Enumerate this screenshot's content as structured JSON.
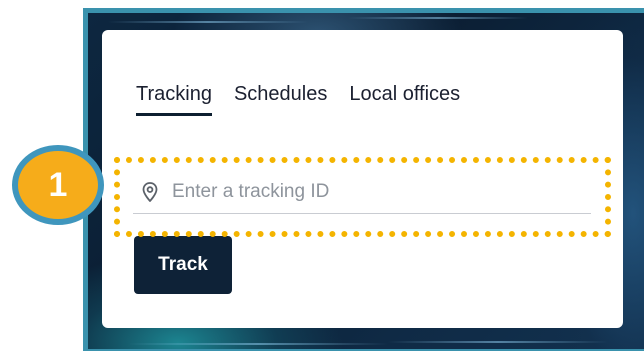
{
  "tabs": [
    {
      "label": "Tracking",
      "active": true
    },
    {
      "label": "Schedules",
      "active": false
    },
    {
      "label": "Local offices",
      "active": false
    }
  ],
  "tracking_input": {
    "placeholder": "Enter a tracking ID",
    "value": "",
    "icon": "location-pin-icon"
  },
  "track_button": {
    "label": "Track"
  },
  "annotation": {
    "step_number": "1",
    "badge_color": "#f6ac1a",
    "badge_border_color": "#3f96bd",
    "highlight_color": "#f4b400"
  },
  "colors": {
    "button_background": "#0e2237",
    "active_tab_underline": "#0d1f30"
  }
}
